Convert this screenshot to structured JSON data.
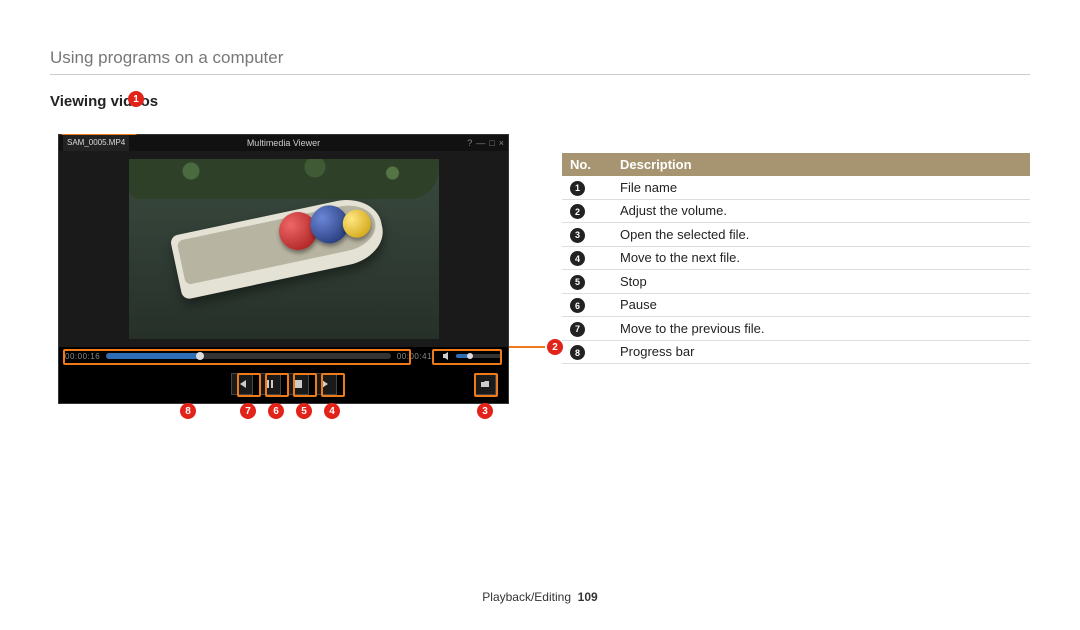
{
  "breadcrumb": "Using programs on a computer",
  "heading": "Viewing videos",
  "app": {
    "filename": "SAM_0005.MP4",
    "title": "Multimedia Viewer",
    "time_current": "00:00:16",
    "time_total": "00:00:41"
  },
  "callouts": {
    "c1": "1",
    "c2": "2",
    "c3": "3",
    "c4": "4",
    "c5": "5",
    "c6": "6",
    "c7": "7",
    "c8": "8"
  },
  "legend": {
    "header_no": "No.",
    "header_desc": "Description",
    "rows": [
      {
        "n": "1",
        "d": "File name"
      },
      {
        "n": "2",
        "d": "Adjust the volume."
      },
      {
        "n": "3",
        "d": "Open the selected file."
      },
      {
        "n": "4",
        "d": "Move to the next file."
      },
      {
        "n": "5",
        "d": "Stop"
      },
      {
        "n": "6",
        "d": "Pause"
      },
      {
        "n": "7",
        "d": "Move to the previous file."
      },
      {
        "n": "8",
        "d": "Progress bar"
      }
    ]
  },
  "footer": {
    "section": "Playback/Editing",
    "page": "109"
  }
}
